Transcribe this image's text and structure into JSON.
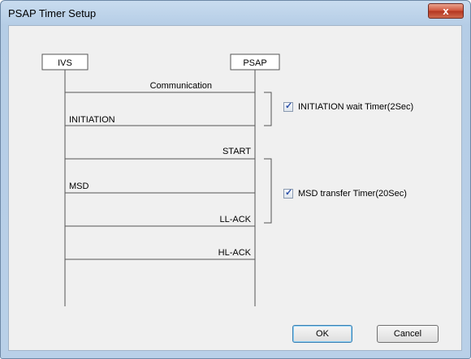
{
  "window": {
    "title": "PSAP Timer Setup",
    "close_glyph": "x"
  },
  "diagram": {
    "ivs_label": "IVS",
    "psap_label": "PSAP",
    "messages": [
      {
        "label": "Communication",
        "align": "right"
      },
      {
        "label": "INITIATION",
        "align": "left"
      },
      {
        "label": "START",
        "align": "right"
      },
      {
        "label": "MSD",
        "align": "left"
      },
      {
        "label": "LL-ACK",
        "align": "right"
      },
      {
        "label": "HL-ACK",
        "align": "right"
      }
    ]
  },
  "timers": {
    "initiation": {
      "label": "INITIATION wait Timer(2Sec)",
      "checked": true
    },
    "msd": {
      "label": "MSD transfer Timer(20Sec)",
      "checked": true
    }
  },
  "buttons": {
    "ok": "OK",
    "cancel": "Cancel"
  }
}
